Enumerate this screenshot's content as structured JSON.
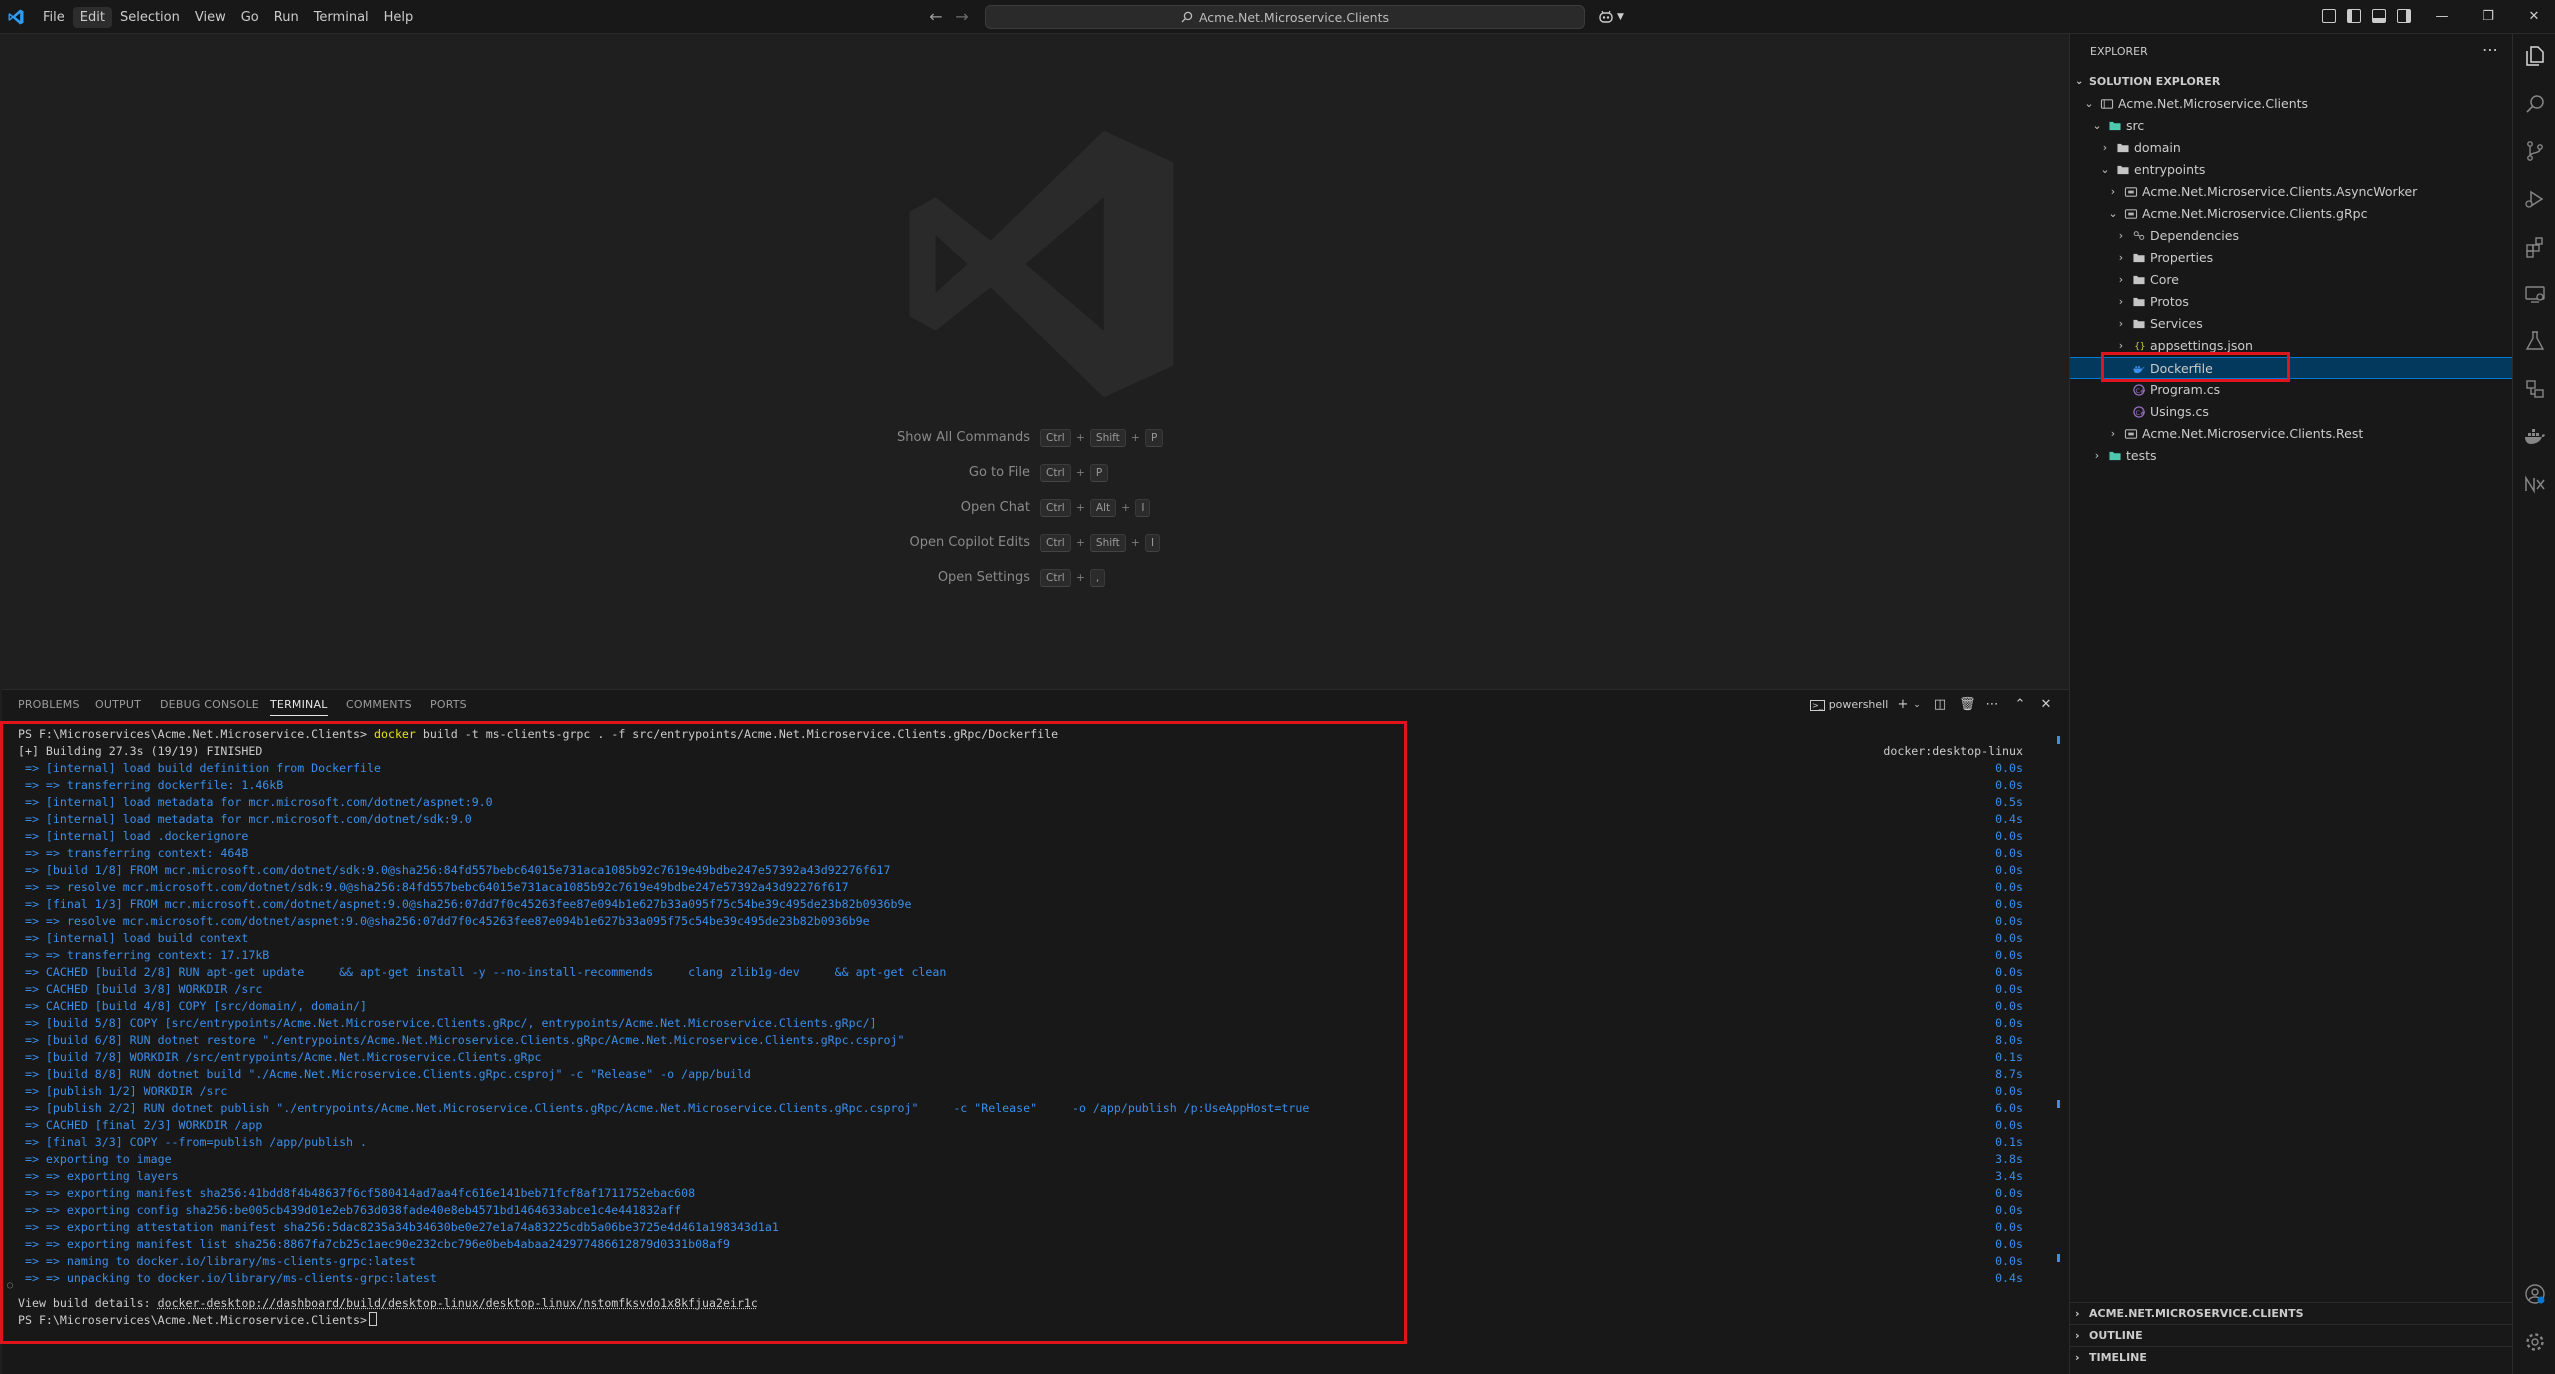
{
  "titlebar": {
    "menus": [
      "File",
      "Edit",
      "Selection",
      "View",
      "Go",
      "Run",
      "Terminal",
      "Help"
    ],
    "active_menu": "Edit",
    "command_center": "Acme.Net.Microservice.Clients"
  },
  "editor": {
    "shortcuts": [
      {
        "label": "Show All Commands",
        "keys": [
          "Ctrl",
          "Shift",
          "P"
        ]
      },
      {
        "label": "Go to File",
        "keys": [
          "Ctrl",
          "P"
        ]
      },
      {
        "label": "Open Chat",
        "keys": [
          "Ctrl",
          "Alt",
          "I"
        ]
      },
      {
        "label": "Open Copilot Edits",
        "keys": [
          "Ctrl",
          "Shift",
          "I"
        ]
      },
      {
        "label": "Open Settings",
        "keys": [
          "Ctrl",
          ","
        ]
      }
    ]
  },
  "panel": {
    "tabs": [
      "PROBLEMS",
      "OUTPUT",
      "DEBUG CONSOLE",
      "TERMINAL",
      "COMMENTS",
      "PORTS"
    ],
    "active_tab": "TERMINAL",
    "shell_label": "powershell"
  },
  "terminal": {
    "prompt": "PS F:\\Microservices\\Acme.Net.Microservice.Clients>",
    "command": "docker build -t ms-clients-grpc . -f src/entrypoints/Acme.Net.Microservice.Clients.gRpc/Dockerfile",
    "building": "[+] Building 27.3s (19/19) FINISHED",
    "builder": "docker:desktop-linux",
    "steps": [
      {
        "text": " => [internal] load build definition from Dockerfile",
        "time": "0.0s"
      },
      {
        "text": " => => transferring dockerfile: 1.46kB",
        "time": "0.0s"
      },
      {
        "text": " => [internal] load metadata for mcr.microsoft.com/dotnet/aspnet:9.0",
        "time": "0.5s"
      },
      {
        "text": " => [internal] load metadata for mcr.microsoft.com/dotnet/sdk:9.0",
        "time": "0.4s"
      },
      {
        "text": " => [internal] load .dockerignore",
        "time": "0.0s"
      },
      {
        "text": " => => transferring context: 464B",
        "time": "0.0s"
      },
      {
        "text": " => [build 1/8] FROM mcr.microsoft.com/dotnet/sdk:9.0@sha256:84fd557bebc64015e731aca1085b92c7619e49bdbe247e57392a43d92276f617",
        "time": "0.0s"
      },
      {
        "text": " => => resolve mcr.microsoft.com/dotnet/sdk:9.0@sha256:84fd557bebc64015e731aca1085b92c7619e49bdbe247e57392a43d92276f617",
        "time": "0.0s"
      },
      {
        "text": " => [final 1/3] FROM mcr.microsoft.com/dotnet/aspnet:9.0@sha256:07dd7f0c45263fee87e094b1e627b33a095f75c54be39c495de23b82b0936b9e",
        "time": "0.0s"
      },
      {
        "text": " => => resolve mcr.microsoft.com/dotnet/aspnet:9.0@sha256:07dd7f0c45263fee87e094b1e627b33a095f75c54be39c495de23b82b0936b9e",
        "time": "0.0s"
      },
      {
        "text": " => [internal] load build context",
        "time": "0.0s"
      },
      {
        "text": " => => transferring context: 17.17kB",
        "time": "0.0s"
      },
      {
        "text": " => CACHED [build 2/8] RUN apt-get update     && apt-get install -y --no-install-recommends     clang zlib1g-dev     && apt-get clean",
        "time": "0.0s"
      },
      {
        "text": " => CACHED [build 3/8] WORKDIR /src",
        "time": "0.0s"
      },
      {
        "text": " => CACHED [build 4/8] COPY [src/domain/, domain/]",
        "time": "0.0s"
      },
      {
        "text": " => [build 5/8] COPY [src/entrypoints/Acme.Net.Microservice.Clients.gRpc/, entrypoints/Acme.Net.Microservice.Clients.gRpc/]",
        "time": "0.0s"
      },
      {
        "text": " => [build 6/8] RUN dotnet restore \"./entrypoints/Acme.Net.Microservice.Clients.gRpc/Acme.Net.Microservice.Clients.gRpc.csproj\"",
        "time": "8.0s"
      },
      {
        "text": " => [build 7/8] WORKDIR /src/entrypoints/Acme.Net.Microservice.Clients.gRpc",
        "time": "0.1s"
      },
      {
        "text": " => [build 8/8] RUN dotnet build \"./Acme.Net.Microservice.Clients.gRpc.csproj\" -c \"Release\" -o /app/build",
        "time": "8.7s"
      },
      {
        "text": " => [publish 1/2] WORKDIR /src",
        "time": "0.0s"
      },
      {
        "text": " => [publish 2/2] RUN dotnet publish \"./entrypoints/Acme.Net.Microservice.Clients.gRpc/Acme.Net.Microservice.Clients.gRpc.csproj\"     -c \"Release\"     -o /app/publish /p:UseAppHost=true",
        "time": "6.0s"
      },
      {
        "text": " => CACHED [final 2/3] WORKDIR /app",
        "time": "0.0s"
      },
      {
        "text": " => [final 3/3] COPY --from=publish /app/publish .",
        "time": "0.1s"
      },
      {
        "text": " => exporting to image",
        "time": "3.8s"
      },
      {
        "text": " => => exporting layers",
        "time": "3.4s"
      },
      {
        "text": " => => exporting manifest sha256:41bdd8f4b48637f6cf580414ad7aa4fc616e141beb71fcf8af1711752ebac608",
        "time": "0.0s"
      },
      {
        "text": " => => exporting config sha256:be005cb439d01e2eb763d038fade40e8eb4571bd1464633abce1c4e441832aff",
        "time": "0.0s"
      },
      {
        "text": " => => exporting attestation manifest sha256:5dac8235a34b34630be0e27e1a74a83225cdb5a06be3725e4d461a198343d1a1",
        "time": "0.0s"
      },
      {
        "text": " => => exporting manifest list sha256:8867fa7cb25c1aec90e232cbc796e0beb4abaa242977486612879d0331b08af9",
        "time": "0.0s"
      },
      {
        "text": " => => naming to docker.io/library/ms-clients-grpc:latest",
        "time": "0.0s"
      },
      {
        "text": " => => unpacking to docker.io/library/ms-clients-grpc:latest",
        "time": "0.4s"
      }
    ],
    "details_label": "View build details:",
    "details_link": "docker-desktop://dashboard/build/desktop-linux/desktop-linux/nstomfksvdo1x8kfjua2eir1c"
  },
  "explorer": {
    "title": "EXPLORER",
    "section": "SOLUTION EXPLORER",
    "tree": [
      {
        "label": "Acme.Net.Microservice.Clients",
        "level": 0,
        "chevron": "open",
        "icon": "solution"
      },
      {
        "label": "src",
        "level": 1,
        "chevron": "open",
        "icon": "src-folder"
      },
      {
        "label": "domain",
        "level": 2,
        "chevron": "closed",
        "icon": "folder"
      },
      {
        "label": "entrypoints",
        "level": 2,
        "chevron": "open",
        "icon": "folder"
      },
      {
        "label": "Acme.Net.Microservice.Clients.AsyncWorker",
        "level": 3,
        "chevron": "closed",
        "icon": "project"
      },
      {
        "label": "Acme.Net.Microservice.Clients.gRpc",
        "level": 3,
        "chevron": "open",
        "icon": "project"
      },
      {
        "label": "Dependencies",
        "level": 4,
        "chevron": "closed",
        "icon": "dependencies"
      },
      {
        "label": "Properties",
        "level": 4,
        "chevron": "closed",
        "icon": "folder"
      },
      {
        "label": "Core",
        "level": 4,
        "chevron": "closed",
        "icon": "folder"
      },
      {
        "label": "Protos",
        "level": 4,
        "chevron": "closed",
        "icon": "folder"
      },
      {
        "label": "Services",
        "level": 4,
        "chevron": "closed",
        "icon": "folder"
      },
      {
        "label": "appsettings.json",
        "level": 4,
        "chevron": "closed",
        "icon": "json"
      },
      {
        "label": "Dockerfile",
        "level": 4,
        "chevron": "none",
        "icon": "docker",
        "selected": true
      },
      {
        "label": "Program.cs",
        "level": 4,
        "chevron": "none",
        "icon": "csharp"
      },
      {
        "label": "Usings.cs",
        "level": 4,
        "chevron": "none",
        "icon": "csharp"
      },
      {
        "label": "Acme.Net.Microservice.Clients.Rest",
        "level": 3,
        "chevron": "closed",
        "icon": "project"
      },
      {
        "label": "tests",
        "level": 1,
        "chevron": "closed",
        "icon": "test-folder"
      }
    ],
    "bottom_sections": [
      "ACME.NET.MICROSERVICE.CLIENTS",
      "OUTLINE",
      "TIMELINE"
    ]
  },
  "colors": {
    "accent": "#0078d4",
    "highlight_box": "#e0151b",
    "terminal_blue": "#3b8eea",
    "command_yellow": "#e5e510"
  }
}
